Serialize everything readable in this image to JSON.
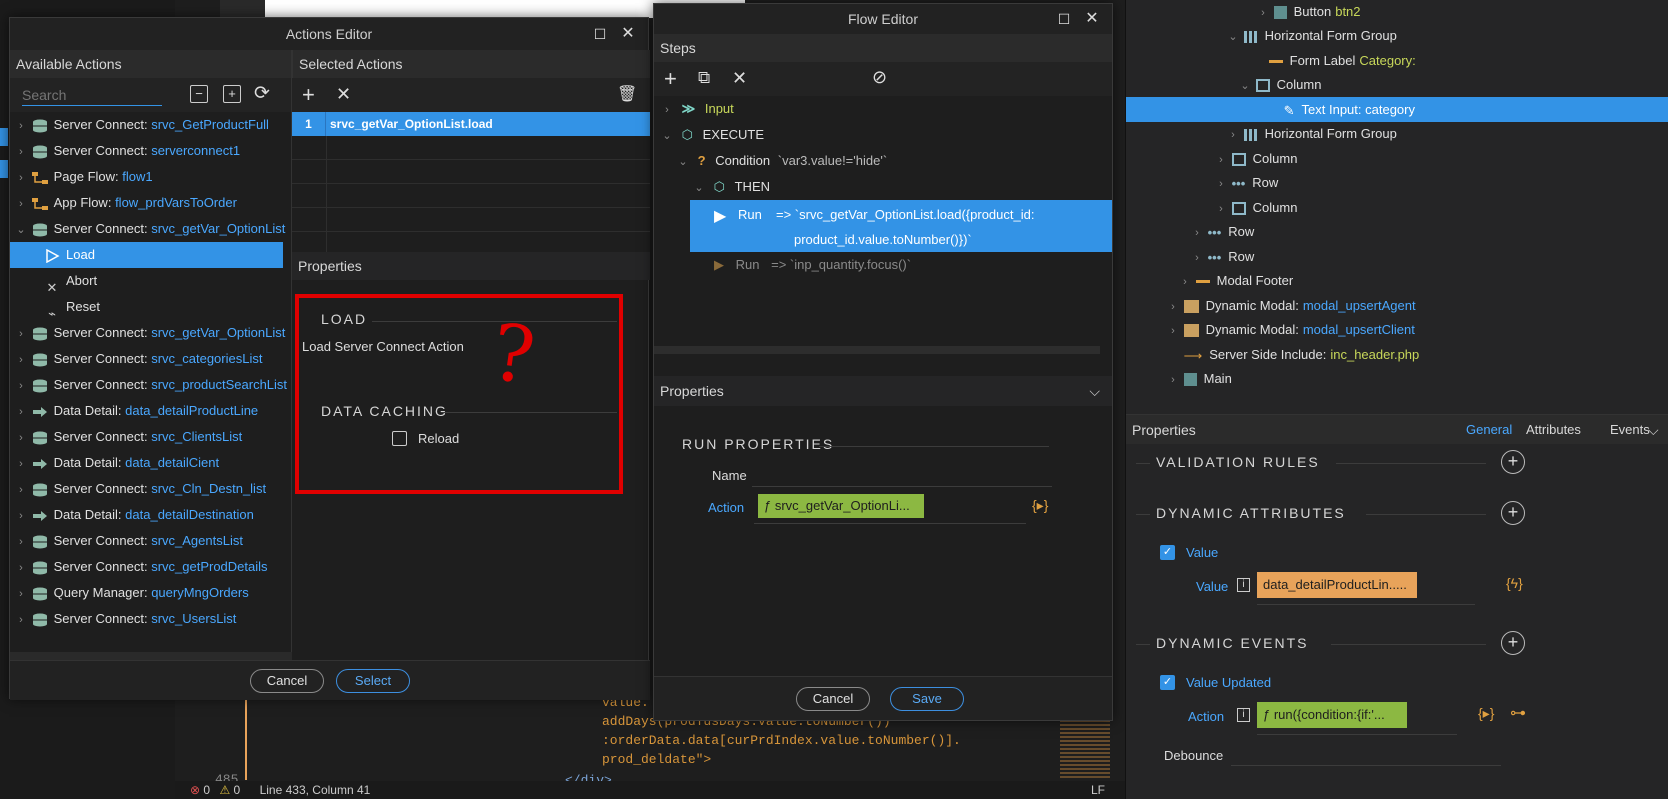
{
  "code_bg": {
    "lines": [
      "value.",
      "addDays(prodTusDays.value.toNumber())",
      ":orderData.data[curPrdIndex.value.toNumber()].",
      "prod_deldate\">",
      "</div>"
    ],
    "line_num": "485"
  },
  "status_bar": {
    "errors": "0",
    "warnings": "0",
    "position": "Line 433, Column 41",
    "eol": "LF"
  },
  "actions_editor": {
    "title": "Actions Editor",
    "available_title": "Available Actions",
    "search_placeholder": "Search",
    "selected_title": "Selected Actions",
    "selected_rows": [
      {
        "num": "1",
        "label": "srvc_getVar_OptionList.load"
      }
    ],
    "properties_title": "Properties",
    "load_section": "LOAD",
    "load_description": "Load Server Connect Action",
    "caching_section": "DATA CACHING",
    "reload_label": "Reload",
    "annotation": "?",
    "tree": [
      {
        "type": "Server Connect:",
        "name": "srvc_GetProductFull",
        "icon": "database"
      },
      {
        "type": "Server Connect:",
        "name": "serverconnect1",
        "icon": "database"
      },
      {
        "type": "Page Flow:",
        "name": "flow1",
        "icon": "flow"
      },
      {
        "type": "App Flow:",
        "name": "flow_prdVarsToOrder",
        "icon": "flow"
      },
      {
        "type": "Server Connect:",
        "name": "srvc_getVar_OptionList",
        "icon": "database",
        "expanded": true
      },
      {
        "type": "",
        "name": "Load",
        "icon": "play",
        "child": true,
        "selected": true
      },
      {
        "type": "",
        "name": "Abort",
        "icon": "x",
        "child": true
      },
      {
        "type": "",
        "name": "Reset",
        "icon": "broom",
        "child": true
      },
      {
        "type": "Server Connect:",
        "name": "srvc_getVar_OptionList",
        "icon": "database"
      },
      {
        "type": "Server Connect:",
        "name": "srvc_categoriesList",
        "icon": "database"
      },
      {
        "type": "Server Connect:",
        "name": "srvc_productSearchList",
        "icon": "database"
      },
      {
        "type": "Data Detail:",
        "name": "data_detailProductLine",
        "icon": "hand"
      },
      {
        "type": "Server Connect:",
        "name": "srvc_ClientsList",
        "icon": "database"
      },
      {
        "type": "Data Detail:",
        "name": "data_detailCient",
        "icon": "hand"
      },
      {
        "type": "Server Connect:",
        "name": "srvc_Cln_Destn_list",
        "icon": "database"
      },
      {
        "type": "Data Detail:",
        "name": "data_detailDestination",
        "icon": "hand"
      },
      {
        "type": "Server Connect:",
        "name": "srvc_AgentsList",
        "icon": "database"
      },
      {
        "type": "Server Connect:",
        "name": "srvc_getProdDetails",
        "icon": "database"
      },
      {
        "type": "Query Manager:",
        "name": "queryMngOrders",
        "icon": "database"
      },
      {
        "type": "Server Connect:",
        "name": "srvc_UsersList",
        "icon": "database"
      }
    ],
    "cancel_label": "Cancel",
    "select_label": "Select"
  },
  "flow_editor": {
    "title": "Flow Editor",
    "steps_title": "Steps",
    "steps": {
      "input": "Input",
      "execute": "EXECUTE",
      "condition_label": "Condition",
      "condition_expr": "`var3.value!='hide'`",
      "then": "THEN",
      "run1_label": "Run",
      "run1_expr_a": "=>  `srvc_getVar_OptionList.load({product_id:",
      "run1_expr_b": "product_id.value.toNumber()})`",
      "run2_label": "Run",
      "run2_expr": "=>  `inp_quantity.focus()`"
    },
    "properties_title": "Properties",
    "run_properties": "RUN PROPERTIES",
    "name_label": "Name",
    "action_label": "Action",
    "action_value": "ƒ srvc_getVar_OptionLi...",
    "cancel_label": "Cancel",
    "save_label": "Save"
  },
  "structure_tree": [
    {
      "label": "Button",
      "value": "btn2",
      "icon": "square"
    },
    {
      "label": "Horizontal Form Group",
      "value": "",
      "icon": "grid"
    },
    {
      "label": "Form Label",
      "value": "Category:",
      "icon": "dash"
    },
    {
      "label": "Column",
      "value": "",
      "icon": "column"
    },
    {
      "label": "Text Input: category",
      "value": "",
      "icon": "pencil",
      "selected": true
    },
    {
      "label": "Horizontal Form Group",
      "value": "",
      "icon": "grid"
    },
    {
      "label": "Column",
      "value": "",
      "icon": "column"
    },
    {
      "label": "Row",
      "value": "",
      "icon": "dots"
    },
    {
      "label": "Column",
      "value": "",
      "icon": "column"
    },
    {
      "label": "Row",
      "value": "",
      "icon": "dots"
    },
    {
      "label": "Row",
      "value": "",
      "icon": "dots"
    },
    {
      "label": "Modal Footer",
      "value": "",
      "icon": "dash"
    },
    {
      "label": "Dynamic Modal:",
      "value": "modal_upsertAgent",
      "icon": "modal"
    },
    {
      "label": "Dynamic Modal:",
      "value": "modal_upsertClient",
      "icon": "modal"
    },
    {
      "label": "Server Side Include:",
      "value": "inc_header.php",
      "icon": "arrow"
    },
    {
      "label": "Main",
      "value": "",
      "icon": "square"
    }
  ],
  "right_props": {
    "title": "Properties",
    "tabs": [
      "General",
      "Attributes",
      "Events"
    ],
    "validation_rules": "VALIDATION RULES",
    "dynamic_attributes": "DYNAMIC ATTRIBUTES",
    "value_checkbox": "Value",
    "value_label": "Value",
    "value_binding": "data_detailProductLin.....",
    "dynamic_events": "DYNAMIC EVENTS",
    "value_updated": "Value Updated",
    "action_label": "Action",
    "action_value": "ƒ run({condition:{if:'...",
    "debounce_label": "Debounce"
  }
}
